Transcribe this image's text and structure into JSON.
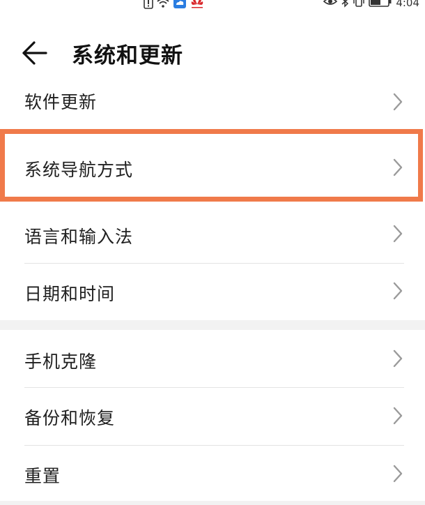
{
  "status_bar": {
    "time": "4:04",
    "icons": [
      "alert-icon",
      "wifi-icon",
      "cloud-icon",
      "huawei-logo-icon",
      "eye-icon",
      "bluetooth-icon",
      "vibrate-icon",
      "battery-icon"
    ]
  },
  "header": {
    "title": "系统和更新",
    "back_icon": "arrow-left-icon"
  },
  "menu": {
    "items": [
      {
        "label": "软件更新"
      },
      {
        "label": "系统导航方式"
      },
      {
        "label": "语言和输入法"
      },
      {
        "label": "日期和时间"
      },
      {
        "label": "手机克隆"
      },
      {
        "label": "备份和恢复"
      },
      {
        "label": "重置"
      }
    ]
  },
  "colors": {
    "highlight": "#f07a4a",
    "chevron": "#9a9a9a",
    "divider": "#e3e3e3",
    "group_gap": "#f2f2f2"
  }
}
